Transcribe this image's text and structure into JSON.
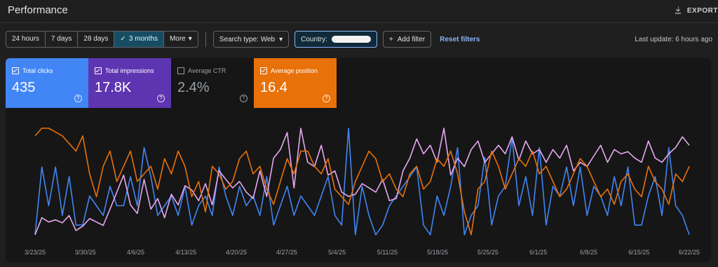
{
  "header": {
    "title": "Performance",
    "export_label": "EXPORT"
  },
  "toolbar": {
    "date_ranges": [
      {
        "label": "24 hours",
        "active": false
      },
      {
        "label": "7 days",
        "active": false
      },
      {
        "label": "28 days",
        "active": false
      },
      {
        "label": "3 months",
        "active": true
      }
    ],
    "more_label": "More",
    "search_type_label": "Search type: Web",
    "country_label": "Country:",
    "add_filter_label": "Add filter",
    "reset_filters_label": "Reset filters",
    "last_update": "Last update: 6 hours ago"
  },
  "metrics": {
    "clicks": {
      "label": "Total clicks",
      "value": "435",
      "checked": true,
      "color": "#4285f4"
    },
    "impressions": {
      "label": "Total impressions",
      "value": "17.8K",
      "checked": true,
      "color": "#5e35b1"
    },
    "ctr": {
      "label": "Average CTR",
      "value": "2.4%",
      "checked": false
    },
    "position": {
      "label": "Average position",
      "value": "16.4",
      "checked": true,
      "color": "#e8710a"
    }
  },
  "chart_data": {
    "type": "line",
    "x_tick_labels": [
      "3/23/25",
      "3/30/25",
      "4/6/25",
      "4/13/25",
      "4/20/25",
      "4/27/25",
      "5/4/25",
      "5/11/25",
      "5/18/25",
      "5/25/25",
      "6/1/25",
      "6/8/25",
      "6/15/25",
      "6/22/25"
    ],
    "x_range": [
      "3/23/25",
      "6/22/25"
    ],
    "y_axis_labels_shown": false,
    "legend": "metric cards above chart",
    "series": [
      {
        "name": "Total clicks",
        "color": "#4285f4",
        "values": [
          1,
          8,
          4,
          8,
          3,
          7,
          2,
          2,
          5,
          4,
          3,
          6,
          4,
          4,
          7,
          4,
          10,
          7,
          3,
          4,
          5,
          3,
          6,
          2,
          4,
          5,
          3,
          8,
          5,
          3,
          6,
          4,
          5,
          3,
          7,
          2,
          4,
          6,
          3,
          5,
          4,
          3,
          5,
          7,
          3,
          2,
          12,
          1,
          6,
          3,
          1,
          2,
          4,
          5,
          6,
          7,
          8,
          2,
          1,
          5,
          3,
          6,
          10,
          1,
          3,
          4,
          9,
          2,
          5,
          6,
          11,
          4,
          7,
          3,
          10,
          2,
          6,
          5,
          8,
          4,
          8,
          3,
          6,
          5,
          3,
          7,
          4,
          8,
          2,
          2,
          5,
          7,
          3,
          10,
          4,
          3,
          1
        ]
      },
      {
        "name": "Total impressions",
        "color": "#e6a8f0",
        "values": [
          80,
          120,
          110,
          115,
          108,
          125,
          90,
          100,
          118,
          110,
          102,
          140,
          180,
          220,
          150,
          130,
          210,
          140,
          165,
          120,
          175,
          150,
          195,
          185,
          160,
          200,
          150,
          230,
          210,
          190,
          205,
          180,
          165,
          230,
          170,
          260,
          280,
          320,
          190,
          330,
          250,
          240,
          290,
          220,
          230,
          180,
          170,
          175,
          200,
          190,
          180,
          210,
          160,
          165,
          230,
          260,
          305,
          270,
          290,
          250,
          330,
          220,
          260,
          240,
          280,
          300,
          250,
          270,
          290,
          270,
          310,
          255,
          300,
          270,
          280,
          250,
          280,
          260,
          290,
          230,
          250,
          240,
          265,
          290,
          250,
          280,
          270,
          275,
          260,
          250,
          300,
          260,
          250,
          270,
          285,
          310,
          290
        ]
      },
      {
        "name": "Average position",
        "color": "#e8710a",
        "values": [
          10,
          9,
          9,
          9.5,
          10,
          11,
          12,
          10,
          15,
          18,
          14,
          12,
          16,
          14,
          12,
          16,
          15,
          14,
          17,
          13,
          15,
          12,
          14,
          18,
          16,
          20,
          14,
          15,
          17,
          16,
          13,
          12,
          15,
          14,
          17,
          19,
          16,
          13,
          15,
          12,
          12,
          14,
          15,
          13,
          17,
          18,
          19,
          16,
          14,
          12,
          13,
          16,
          15,
          17,
          18,
          15,
          14,
          17,
          16,
          13,
          14,
          12,
          15,
          20,
          23,
          17,
          16,
          12,
          14,
          17,
          15,
          13,
          14,
          12,
          15,
          14,
          16,
          18,
          17,
          15,
          13,
          14,
          16,
          18,
          17,
          19,
          16,
          15,
          17,
          18,
          14,
          16,
          17,
          19,
          15,
          16,
          14
        ]
      }
    ]
  }
}
